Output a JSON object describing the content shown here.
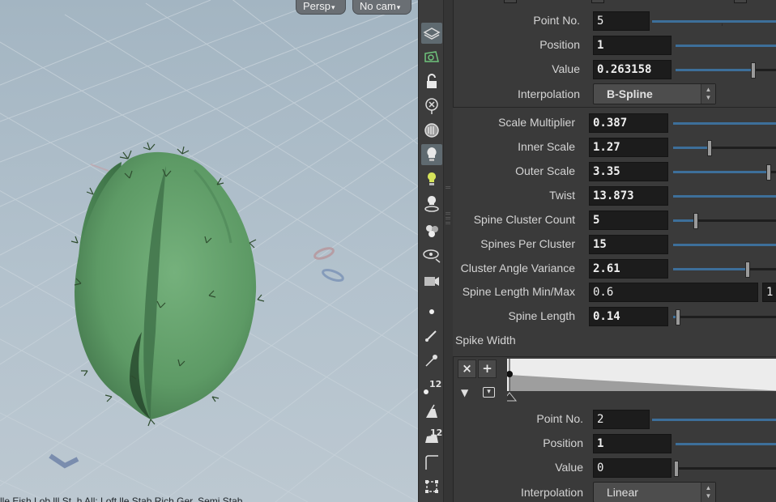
{
  "viewport": {
    "camera_menu": "Persp",
    "cam_menu": "No cam",
    "status_text": "lle   Eish       Lob lll    St. h All: Loft lle      Stab Rich       Ger.  Semi   Stab"
  },
  "toolbar": {
    "icons": [
      "display-options-icon",
      "ghost-object-icon",
      "lock-icon",
      "x-ray-icon",
      "shading-icon",
      "light-icon",
      "lightbulb-icon",
      "light-link-icon",
      "particles-icon",
      "camera-view-icon",
      "camera-flipbook-icon",
      "point-icon",
      "brush-icon",
      "pen-icon",
      "point-number-icon",
      "eraser-icon",
      "prim-number-icon",
      "curve-icon",
      "transform-icon"
    ],
    "point_number_badge": "12",
    "prim_number_badge": "12"
  },
  "ramp_top": {
    "point_no": {
      "label": "Point No.",
      "value": "5"
    },
    "position": {
      "label": "Position",
      "value": "1"
    },
    "value": {
      "label": "Value",
      "value": "0.263158",
      "fraction": 0.68
    },
    "interpolation": {
      "label": "Interpolation",
      "value": "B-Spline"
    }
  },
  "params": [
    {
      "label": "Scale Multiplier",
      "value": "0.387",
      "fraction": 1.0
    },
    {
      "label": "Inner Scale",
      "value": "1.27",
      "fraction": 0.32
    },
    {
      "label": "Outer Scale",
      "value": "3.35",
      "fraction": 0.84
    },
    {
      "label": "Twist",
      "value": "13.873",
      "fraction": 1.05
    },
    {
      "label": "Spine Cluster Count",
      "value": "5",
      "fraction": 0.2
    },
    {
      "label": "Spines Per Cluster",
      "value": "15",
      "fraction": 1.05
    },
    {
      "label": "Cluster Angle Variance",
      "value": "2.61",
      "fraction": 0.66
    },
    {
      "label": "Spine Length Min/Max",
      "value": "0.6",
      "value2": "1"
    },
    {
      "label": "Spine Length",
      "value": "0.14",
      "fraction": 0.04
    }
  ],
  "spike_width": {
    "label": "Spike Width",
    "remove_label": "×",
    "add_label": "+",
    "point_no": {
      "label": "Point No.",
      "value": "2"
    },
    "position": {
      "label": "Position",
      "value": "1"
    },
    "value": {
      "label": "Value",
      "value": "0",
      "fraction": 0.0
    },
    "interpolation": {
      "label": "Interpolation",
      "value": "Linear"
    }
  },
  "colors": {
    "viewport_bg": "#afbfca",
    "cactus": "#5f9c67",
    "slider": "#3d6f9a",
    "panel": "#3a3a3a",
    "field": "#1c1c1c"
  }
}
